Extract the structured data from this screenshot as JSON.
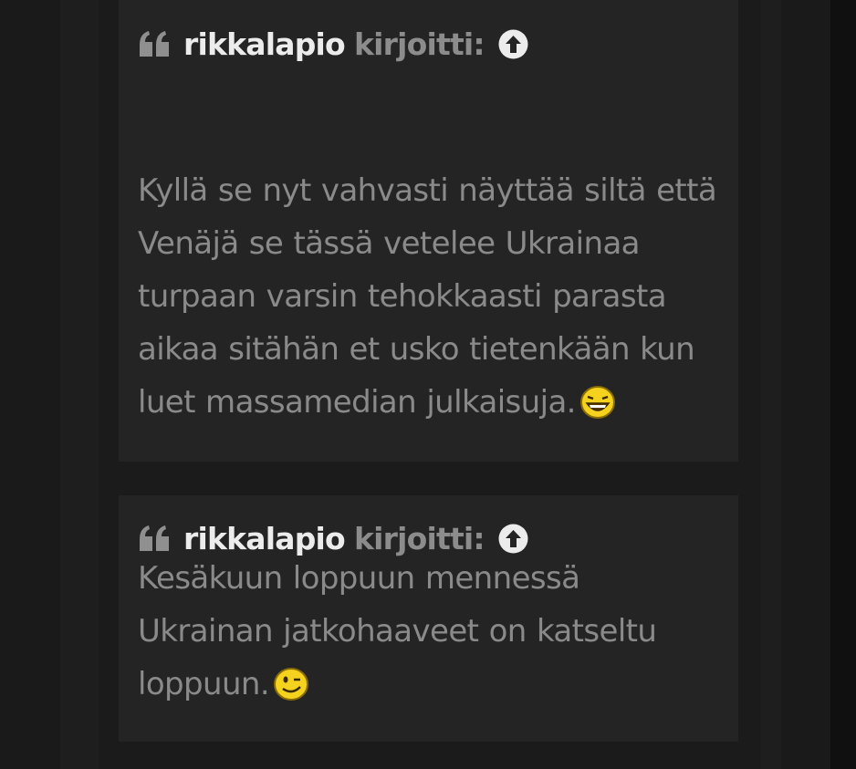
{
  "quotes": [
    {
      "author": "rikkalapio",
      "wrote_label": "kirjoitti:",
      "body": "Kyllä se nyt vahvasti näyttää siltä että Venäjä se tässä vetelee Ukrainaa turpaan varsin tehokkaasti parasta aikaa sitähän et usko tietenkään kun luet massamedian julkaisuja.",
      "emoji": "laughing-smiley-icon"
    },
    {
      "author": "rikkalapio",
      "wrote_label": "kirjoitti:",
      "body": "Kesäkuun loppuun mennessä Ukrainan jatkohaaveet on katseltu loppuun.",
      "emoji": "wink-smiley-icon"
    }
  ],
  "icons": {
    "quote": "quote-mark-icon",
    "jump": "arrow-up-circle-icon"
  },
  "colors": {
    "background": "#1a1a1a",
    "quote_box": "#242424",
    "author_text": "#ececec",
    "muted_text": "#8a8a8a",
    "emoji_yellow": "#f5d21e"
  }
}
